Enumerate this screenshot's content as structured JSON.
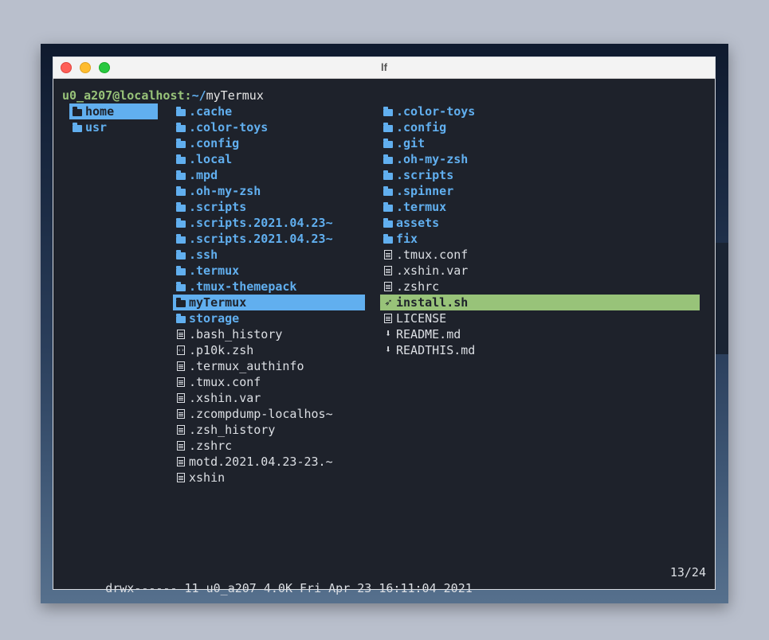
{
  "window": {
    "title": "lf"
  },
  "prompt": {
    "user_host": "u0_a207@localhost",
    "separator": ":",
    "path_prefix": "~/",
    "current_dir": "myTermux"
  },
  "parent_column": [
    {
      "name": "home",
      "type": "dir",
      "selected": true,
      "icon": "folder-icon"
    },
    {
      "name": "usr",
      "type": "dir",
      "selected": false,
      "icon": "folder-icon"
    }
  ],
  "current_column": [
    {
      "name": ".cache",
      "type": "dir",
      "icon": "folder-icon"
    },
    {
      "name": ".color-toys",
      "type": "dir",
      "icon": "folder-icon"
    },
    {
      "name": ".config",
      "type": "dir",
      "icon": "folder-icon"
    },
    {
      "name": ".local",
      "type": "dir",
      "icon": "folder-icon"
    },
    {
      "name": ".mpd",
      "type": "dir",
      "icon": "folder-icon"
    },
    {
      "name": ".oh-my-zsh",
      "type": "dir",
      "icon": "folder-icon"
    },
    {
      "name": ".scripts",
      "type": "dir",
      "icon": "folder-icon"
    },
    {
      "name": ".scripts.2021.04.23~",
      "type": "dir",
      "icon": "folder-icon"
    },
    {
      "name": ".scripts.2021.04.23~",
      "type": "dir",
      "icon": "folder-icon"
    },
    {
      "name": ".ssh",
      "type": "dir",
      "icon": "folder-icon"
    },
    {
      "name": ".termux",
      "type": "dir",
      "icon": "folder-icon"
    },
    {
      "name": ".tmux-themepack",
      "type": "dir",
      "icon": "folder-icon"
    },
    {
      "name": "myTermux",
      "type": "dir",
      "selected": true,
      "icon": "folder-icon"
    },
    {
      "name": "storage",
      "type": "dir",
      "icon": "folder-icon"
    },
    {
      "name": ".bash_history",
      "type": "file",
      "icon": "file-icon"
    },
    {
      "name": ".p10k.zsh",
      "type": "file",
      "icon": "code-file-icon"
    },
    {
      "name": ".termux_authinfo",
      "type": "file",
      "icon": "file-icon"
    },
    {
      "name": ".tmux.conf",
      "type": "file",
      "icon": "file-icon"
    },
    {
      "name": ".xshin.var",
      "type": "file",
      "icon": "file-icon"
    },
    {
      "name": ".zcompdump-localhos~",
      "type": "file",
      "icon": "file-icon"
    },
    {
      "name": ".zsh_history",
      "type": "file",
      "icon": "file-icon"
    },
    {
      "name": ".zshrc",
      "type": "file",
      "icon": "file-icon"
    },
    {
      "name": "motd.2021.04.23-23.~",
      "type": "file",
      "icon": "file-icon"
    },
    {
      "name": "xshin",
      "type": "file",
      "icon": "file-icon"
    }
  ],
  "preview_column": [
    {
      "name": ".color-toys",
      "type": "dir",
      "icon": "folder-icon"
    },
    {
      "name": ".config",
      "type": "dir",
      "icon": "folder-icon"
    },
    {
      "name": ".git",
      "type": "dir",
      "icon": "folder-icon"
    },
    {
      "name": ".oh-my-zsh",
      "type": "dir",
      "icon": "folder-icon"
    },
    {
      "name": ".scripts",
      "type": "dir",
      "icon": "folder-icon"
    },
    {
      "name": ".spinner",
      "type": "dir",
      "icon": "folder-icon"
    },
    {
      "name": ".termux",
      "type": "dir",
      "icon": "folder-icon"
    },
    {
      "name": "assets",
      "type": "dir",
      "icon": "folder-icon"
    },
    {
      "name": "fix",
      "type": "dir",
      "icon": "folder-icon"
    },
    {
      "name": ".tmux.conf",
      "type": "file",
      "icon": "file-icon"
    },
    {
      "name": ".xshin.var",
      "type": "file",
      "icon": "file-icon"
    },
    {
      "name": ".zshrc",
      "type": "file",
      "icon": "file-icon"
    },
    {
      "name": "install.sh",
      "type": "file",
      "selected": true,
      "icon": "rocket-icon"
    },
    {
      "name": "LICENSE",
      "type": "file",
      "icon": "file-icon"
    },
    {
      "name": "README.md",
      "type": "file",
      "icon": "markdown-icon"
    },
    {
      "name": "READTHIS.md",
      "type": "file",
      "icon": "markdown-icon"
    }
  ],
  "status": {
    "info": "drwx------ 11 u0_a207 4.0K Fri Apr 23 16:11:04 2021",
    "position": "13/24"
  },
  "colors": {
    "background": "#1e222b",
    "dir": "#61afef",
    "file": "#dcdfe4",
    "selection_dir": "#61afef",
    "selection_file": "#98c379",
    "prompt_user": "#98c379"
  }
}
